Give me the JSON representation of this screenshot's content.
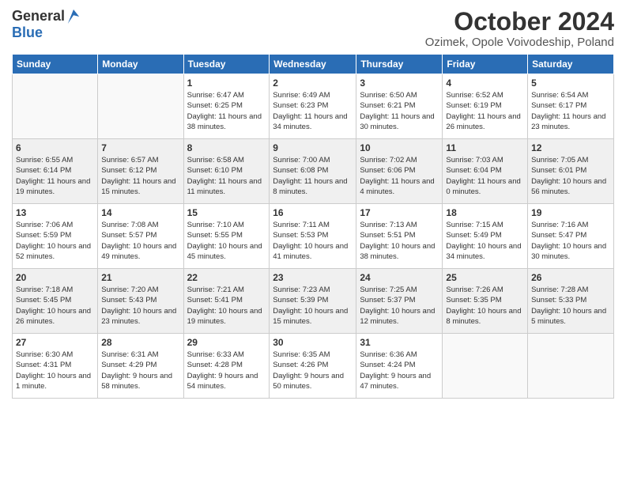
{
  "logo": {
    "general": "General",
    "blue": "Blue"
  },
  "header": {
    "month": "October 2024",
    "location": "Ozimek, Opole Voivodeship, Poland"
  },
  "weekdays": [
    "Sunday",
    "Monday",
    "Tuesday",
    "Wednesday",
    "Thursday",
    "Friday",
    "Saturday"
  ],
  "weeks": [
    [
      {
        "day": "",
        "info": ""
      },
      {
        "day": "",
        "info": ""
      },
      {
        "day": "1",
        "info": "Sunrise: 6:47 AM\nSunset: 6:25 PM\nDaylight: 11 hours and 38 minutes."
      },
      {
        "day": "2",
        "info": "Sunrise: 6:49 AM\nSunset: 6:23 PM\nDaylight: 11 hours and 34 minutes."
      },
      {
        "day": "3",
        "info": "Sunrise: 6:50 AM\nSunset: 6:21 PM\nDaylight: 11 hours and 30 minutes."
      },
      {
        "day": "4",
        "info": "Sunrise: 6:52 AM\nSunset: 6:19 PM\nDaylight: 11 hours and 26 minutes."
      },
      {
        "day": "5",
        "info": "Sunrise: 6:54 AM\nSunset: 6:17 PM\nDaylight: 11 hours and 23 minutes."
      }
    ],
    [
      {
        "day": "6",
        "info": "Sunrise: 6:55 AM\nSunset: 6:14 PM\nDaylight: 11 hours and 19 minutes."
      },
      {
        "day": "7",
        "info": "Sunrise: 6:57 AM\nSunset: 6:12 PM\nDaylight: 11 hours and 15 minutes."
      },
      {
        "day": "8",
        "info": "Sunrise: 6:58 AM\nSunset: 6:10 PM\nDaylight: 11 hours and 11 minutes."
      },
      {
        "day": "9",
        "info": "Sunrise: 7:00 AM\nSunset: 6:08 PM\nDaylight: 11 hours and 8 minutes."
      },
      {
        "day": "10",
        "info": "Sunrise: 7:02 AM\nSunset: 6:06 PM\nDaylight: 11 hours and 4 minutes."
      },
      {
        "day": "11",
        "info": "Sunrise: 7:03 AM\nSunset: 6:04 PM\nDaylight: 11 hours and 0 minutes."
      },
      {
        "day": "12",
        "info": "Sunrise: 7:05 AM\nSunset: 6:01 PM\nDaylight: 10 hours and 56 minutes."
      }
    ],
    [
      {
        "day": "13",
        "info": "Sunrise: 7:06 AM\nSunset: 5:59 PM\nDaylight: 10 hours and 52 minutes."
      },
      {
        "day": "14",
        "info": "Sunrise: 7:08 AM\nSunset: 5:57 PM\nDaylight: 10 hours and 49 minutes."
      },
      {
        "day": "15",
        "info": "Sunrise: 7:10 AM\nSunset: 5:55 PM\nDaylight: 10 hours and 45 minutes."
      },
      {
        "day": "16",
        "info": "Sunrise: 7:11 AM\nSunset: 5:53 PM\nDaylight: 10 hours and 41 minutes."
      },
      {
        "day": "17",
        "info": "Sunrise: 7:13 AM\nSunset: 5:51 PM\nDaylight: 10 hours and 38 minutes."
      },
      {
        "day": "18",
        "info": "Sunrise: 7:15 AM\nSunset: 5:49 PM\nDaylight: 10 hours and 34 minutes."
      },
      {
        "day": "19",
        "info": "Sunrise: 7:16 AM\nSunset: 5:47 PM\nDaylight: 10 hours and 30 minutes."
      }
    ],
    [
      {
        "day": "20",
        "info": "Sunrise: 7:18 AM\nSunset: 5:45 PM\nDaylight: 10 hours and 26 minutes."
      },
      {
        "day": "21",
        "info": "Sunrise: 7:20 AM\nSunset: 5:43 PM\nDaylight: 10 hours and 23 minutes."
      },
      {
        "day": "22",
        "info": "Sunrise: 7:21 AM\nSunset: 5:41 PM\nDaylight: 10 hours and 19 minutes."
      },
      {
        "day": "23",
        "info": "Sunrise: 7:23 AM\nSunset: 5:39 PM\nDaylight: 10 hours and 15 minutes."
      },
      {
        "day": "24",
        "info": "Sunrise: 7:25 AM\nSunset: 5:37 PM\nDaylight: 10 hours and 12 minutes."
      },
      {
        "day": "25",
        "info": "Sunrise: 7:26 AM\nSunset: 5:35 PM\nDaylight: 10 hours and 8 minutes."
      },
      {
        "day": "26",
        "info": "Sunrise: 7:28 AM\nSunset: 5:33 PM\nDaylight: 10 hours and 5 minutes."
      }
    ],
    [
      {
        "day": "27",
        "info": "Sunrise: 6:30 AM\nSunset: 4:31 PM\nDaylight: 10 hours and 1 minute."
      },
      {
        "day": "28",
        "info": "Sunrise: 6:31 AM\nSunset: 4:29 PM\nDaylight: 9 hours and 58 minutes."
      },
      {
        "day": "29",
        "info": "Sunrise: 6:33 AM\nSunset: 4:28 PM\nDaylight: 9 hours and 54 minutes."
      },
      {
        "day": "30",
        "info": "Sunrise: 6:35 AM\nSunset: 4:26 PM\nDaylight: 9 hours and 50 minutes."
      },
      {
        "day": "31",
        "info": "Sunrise: 6:36 AM\nSunset: 4:24 PM\nDaylight: 9 hours and 47 minutes."
      },
      {
        "day": "",
        "info": ""
      },
      {
        "day": "",
        "info": ""
      }
    ]
  ]
}
